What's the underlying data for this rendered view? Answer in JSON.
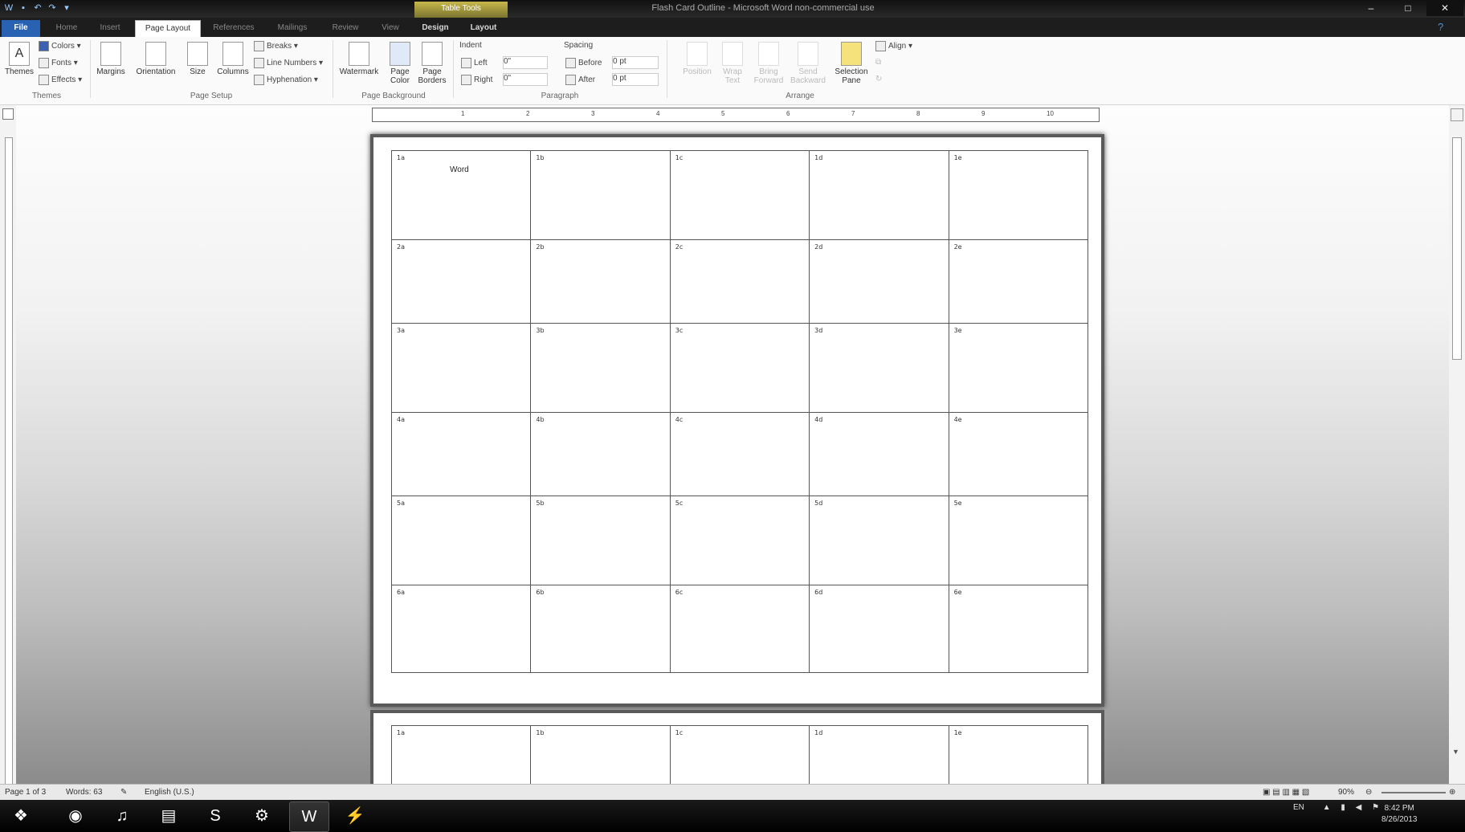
{
  "window": {
    "title": "Flash Card Outline - Microsoft Word non-commercial use",
    "context_tab_group": "Table Tools",
    "controls": [
      "–",
      "□",
      "✕"
    ]
  },
  "tabs": [
    {
      "label": "File",
      "state": "file"
    },
    {
      "label": "Home",
      "state": ""
    },
    {
      "label": "Insert",
      "state": ""
    },
    {
      "label": "Page Layout",
      "state": "active"
    },
    {
      "label": "References",
      "state": ""
    },
    {
      "label": "Mailings",
      "state": ""
    },
    {
      "label": "Review",
      "state": ""
    },
    {
      "label": "View",
      "state": ""
    },
    {
      "label": "Design",
      "state": "ctx"
    },
    {
      "label": "Layout",
      "state": "ctx"
    }
  ],
  "ribbon": {
    "themes": {
      "big": "Themes",
      "colors": "Colors",
      "fonts": "Fonts",
      "effects": "Effects",
      "group": "Themes"
    },
    "page_setup": {
      "margins": "Margins",
      "orientation": "Orientation",
      "size": "Size",
      "columns": "Columns",
      "breaks": "Breaks",
      "line_numbers": "Line Numbers",
      "hyphenation": "Hyphenation",
      "group": "Page Setup"
    },
    "page_background": {
      "watermark": "Watermark",
      "page_color": "Page Color",
      "page_borders": "Page Borders",
      "group": "Page Background"
    },
    "paragraph": {
      "indent": "Indent",
      "left": "Left",
      "left_val": "0\"",
      "right": "Right",
      "right_val": "0\"",
      "spacing": "Spacing",
      "before": "Before",
      "before_val": "0 pt",
      "after": "After",
      "after_val": "0 pt",
      "group": "Paragraph"
    },
    "arrange": {
      "position": "Position",
      "wrap_text": "Wrap Text",
      "bring_forward": "Bring Forward",
      "send_backward": "Send Backward",
      "selection_pane": "Selection Pane",
      "align": "Align",
      "group": "Arrange"
    }
  },
  "ruler": {
    "ticks": [
      "1",
      "2",
      "3",
      "4",
      "5",
      "6",
      "7",
      "8",
      "9",
      "10"
    ]
  },
  "document": {
    "page1_rows": [
      [
        "1a",
        "1b",
        "1c",
        "1d",
        "1e"
      ],
      [
        "2a",
        "2b",
        "2c",
        "2d",
        "2e"
      ],
      [
        "3a",
        "3b",
        "3c",
        "3d",
        "3e"
      ],
      [
        "4a",
        "4b",
        "4c",
        "4d",
        "4e"
      ],
      [
        "5a",
        "5b",
        "5c",
        "5d",
        "5e"
      ],
      [
        "6a",
        "6b",
        "6c",
        "6d",
        "6e"
      ]
    ],
    "typed_word": "Word",
    "page2_rows": [
      [
        "1a",
        "1b",
        "1c",
        "1d",
        "1e"
      ]
    ]
  },
  "statusbar": {
    "page": "Page 1 of 3",
    "words": "Words: 63",
    "language": "English (U.S.)",
    "zoom": "90%"
  },
  "taskbar": {
    "apps": [
      {
        "name": "start-orb-icon",
        "glyph": "❖"
      },
      {
        "name": "chrome-icon",
        "glyph": "◉"
      },
      {
        "name": "spotify-icon",
        "glyph": "♫"
      },
      {
        "name": "file-explorer-icon",
        "glyph": "▤"
      },
      {
        "name": "skype-icon",
        "glyph": "S"
      },
      {
        "name": "steam-icon",
        "glyph": "⚙"
      },
      {
        "name": "word-icon",
        "glyph": "W"
      },
      {
        "name": "winamp-icon",
        "glyph": "⚡"
      }
    ],
    "tray_lang": "EN",
    "clock_time": "8:42 PM",
    "clock_date": "8/26/2013"
  }
}
